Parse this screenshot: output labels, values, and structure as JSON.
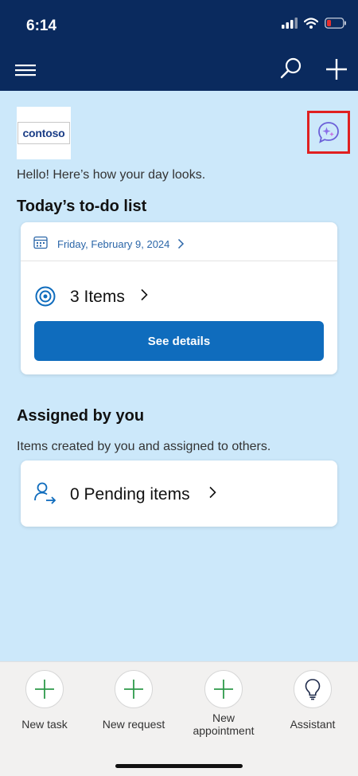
{
  "status_bar": {
    "time": "6:14"
  },
  "header": {
    "menu_icon": "hamburger-icon",
    "search_icon": "search-icon",
    "add_icon": "plus-icon"
  },
  "logo": {
    "text": "contoso"
  },
  "copilot": {
    "icon": "copilot-sparkle-icon",
    "accent": "#7b6fe0"
  },
  "greeting": "Hello! Here’s how your day looks.",
  "todo": {
    "title": "Today’s to-do list",
    "date": "Friday, February 9, 2024",
    "items_label": "3 Items",
    "button_label": "See details"
  },
  "assigned": {
    "title": "Assigned by you",
    "subtitle": "Items created by you and assigned to others.",
    "pending_label": "0 Pending items"
  },
  "bottom_bar": {
    "items": [
      {
        "label": "New task",
        "icon": "plus-icon"
      },
      {
        "label": "New request",
        "icon": "plus-icon"
      },
      {
        "label": "New appointment",
        "icon": "plus-icon"
      },
      {
        "label": "Assistant",
        "icon": "lightbulb-icon"
      }
    ]
  },
  "colors": {
    "header_bg": "#0a2a5e",
    "page_bg": "#cce8fa",
    "primary": "#0f6cbd",
    "plus_green": "#2e9a4a"
  }
}
